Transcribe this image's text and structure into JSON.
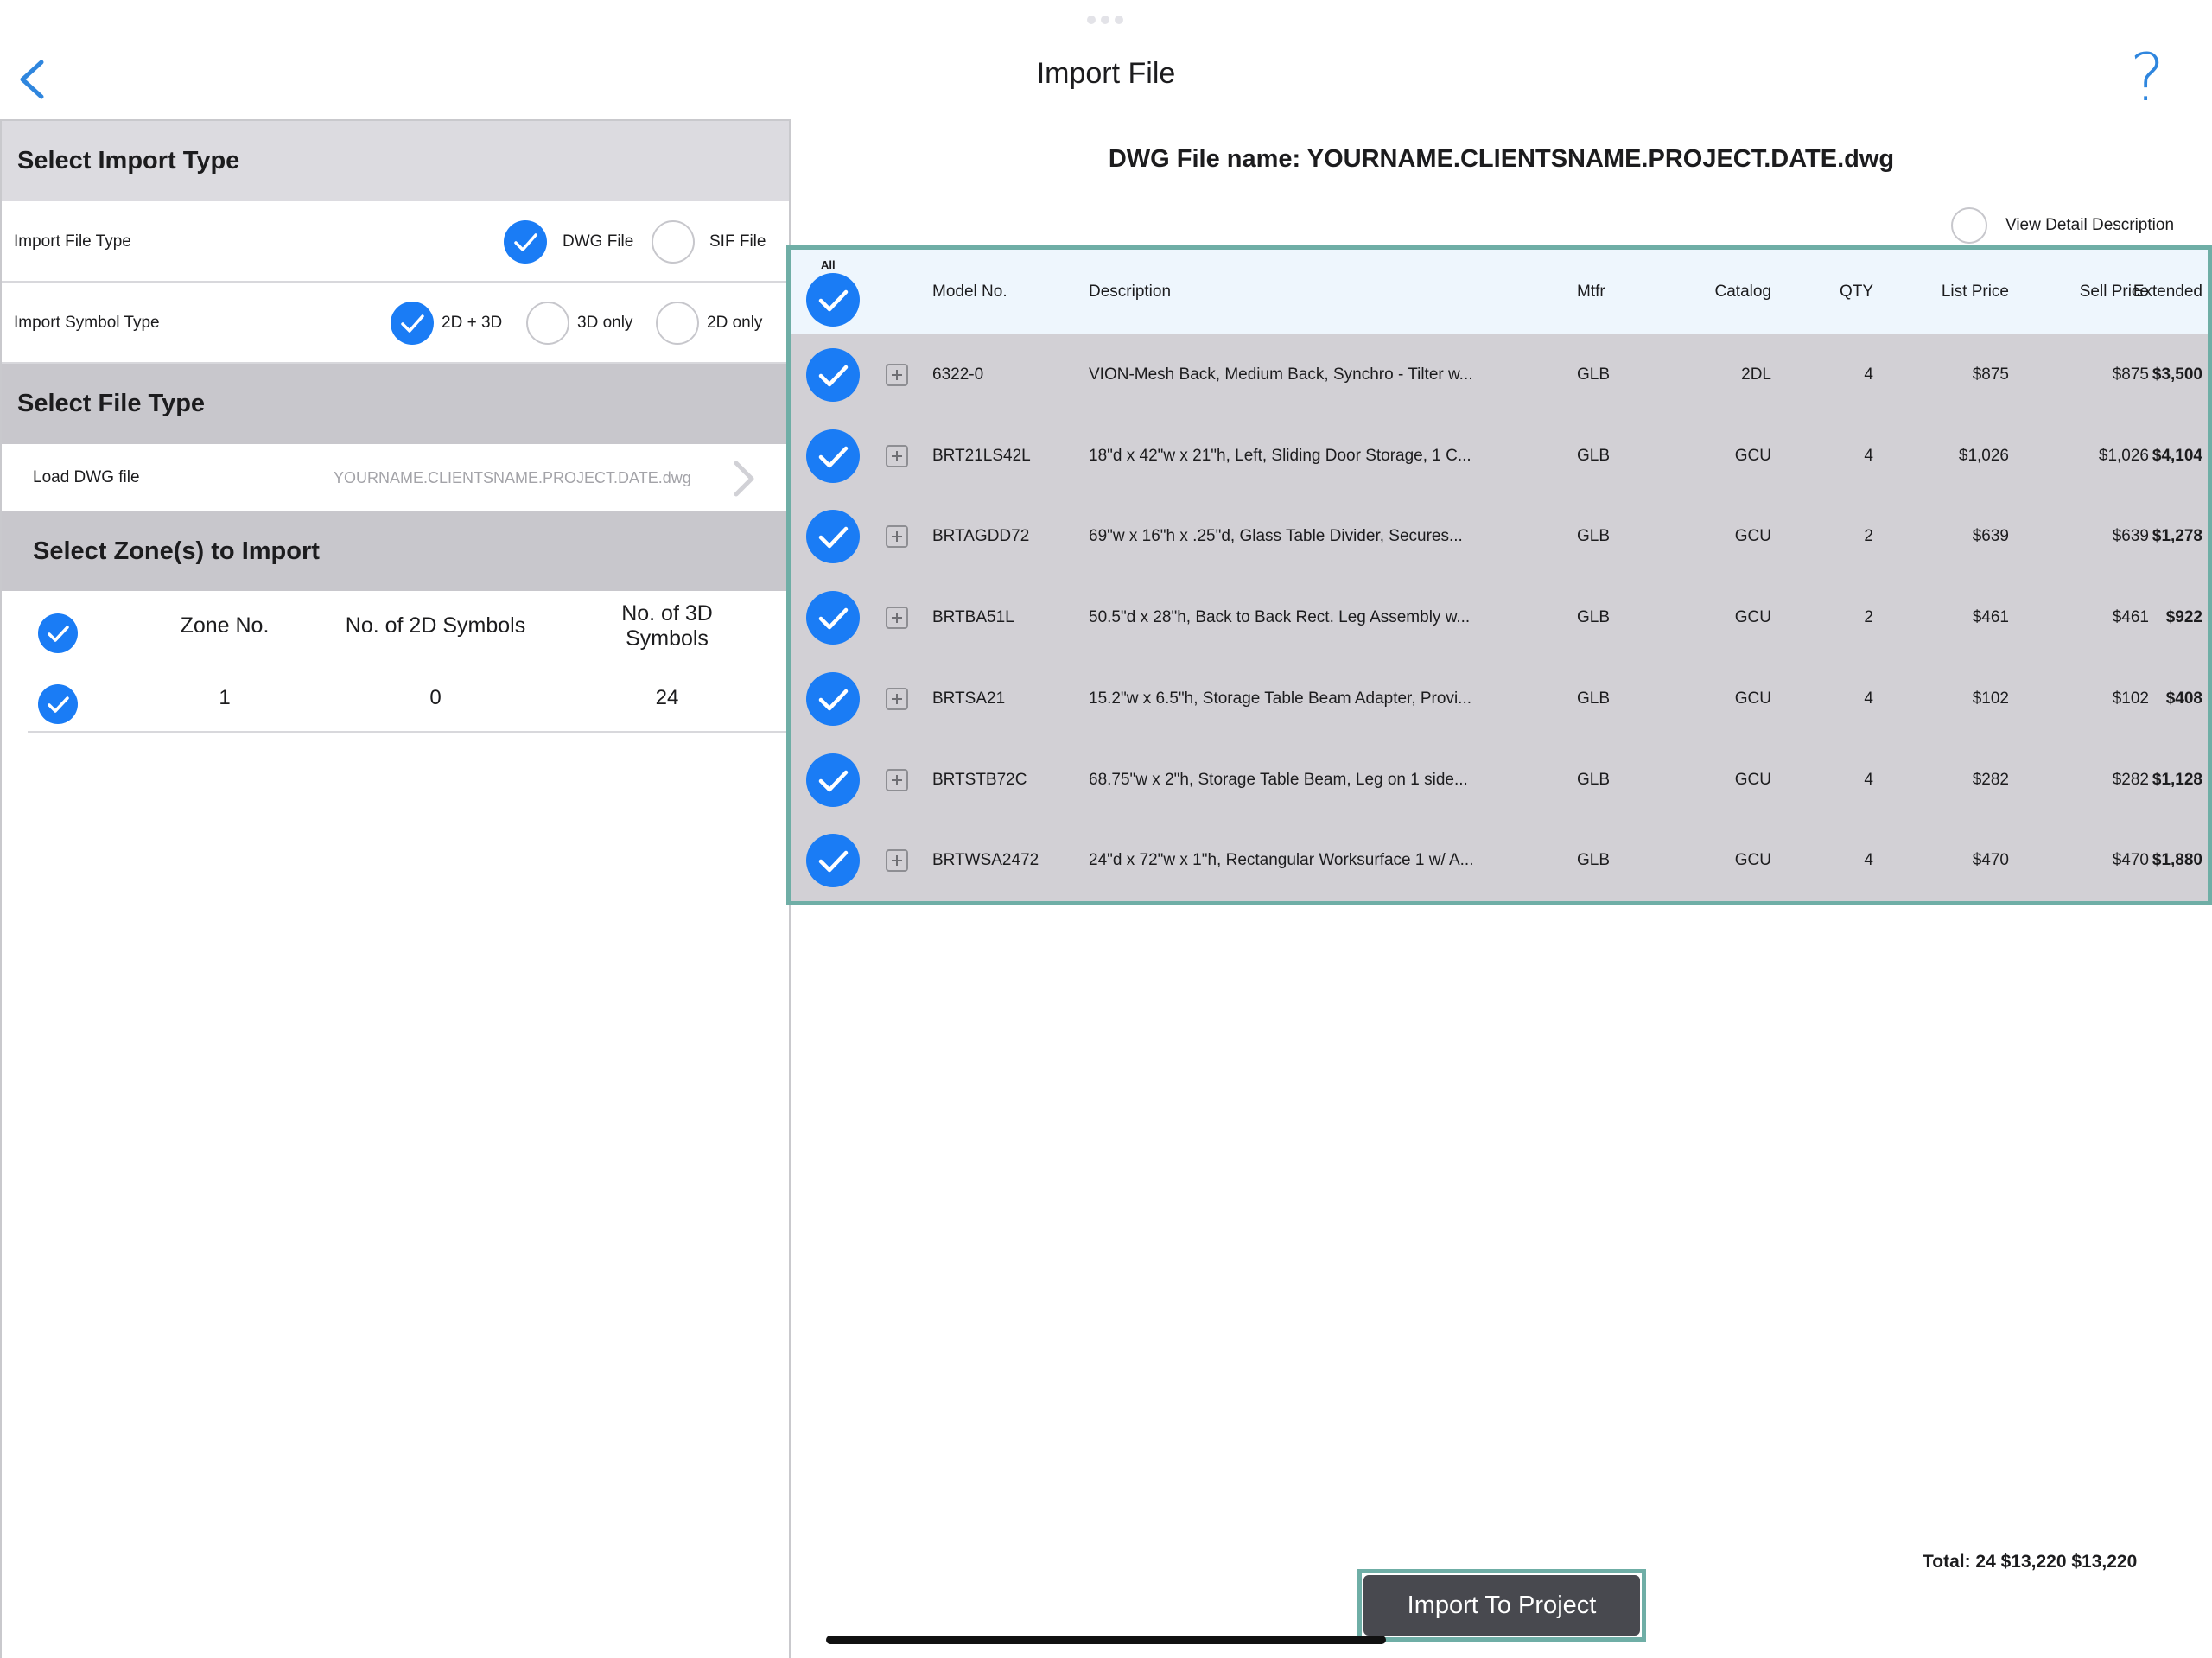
{
  "header": {
    "title": "Import File",
    "back_icon": "chevron-left-icon",
    "help_label": "?"
  },
  "import_type": {
    "section_title": "Select Import Type",
    "file_type_label": "Import File Type",
    "file_type_options": [
      {
        "label": "DWG File",
        "selected": true
      },
      {
        "label": "SIF File",
        "selected": false
      }
    ],
    "symbol_type_label": "Import Symbol Type",
    "symbol_type_options": [
      {
        "label": "2D + 3D",
        "selected": true
      },
      {
        "label": "3D only",
        "selected": false
      },
      {
        "label": "2D only",
        "selected": false
      }
    ]
  },
  "file_type": {
    "section_title": "Select File Type",
    "load_label": "Load DWG file",
    "file_path": "YOURNAME.CLIENTSNAME.PROJECT.DATE.dwg"
  },
  "zones": {
    "section_title": "Select Zone(s) to Import",
    "headers": {
      "zone_no": "Zone No.",
      "no_2d": "No. of 2D Symbols",
      "no_3d_line1": "No. of 3D",
      "no_3d_line2": "Symbols"
    },
    "rows": [
      {
        "zone_no": "1",
        "no_2d": "0",
        "no_3d": "24",
        "selected": true
      }
    ]
  },
  "file_info": {
    "title": "DWG File name: YOURNAME.CLIENTSNAME.PROJECT.DATE.dwg",
    "detail_toggle_label": "View Detail Description"
  },
  "table": {
    "all_label": "All",
    "columns": {
      "model": "Model No.",
      "description": "Description",
      "mtfr": "Mtfr",
      "catalog": "Catalog",
      "qty": "QTY",
      "list": "List Price",
      "sell": "Sell Price",
      "extended": "Extended"
    },
    "rows": [
      {
        "model": "6322-0",
        "description": "VION-Mesh Back, Medium Back, Synchro - Tilter w...",
        "mtfr": "GLB",
        "catalog": "2DL",
        "qty": "4",
        "list": "$875",
        "sell": "$875",
        "extended": "$3,500"
      },
      {
        "model": "BRT21LS42L",
        "description": "18\"d x 42\"w x 21\"h, Left, Sliding Door Storage, 1 C...",
        "mtfr": "GLB",
        "catalog": "GCU",
        "qty": "4",
        "list": "$1,026",
        "sell": "$1,026",
        "extended": "$4,104"
      },
      {
        "model": "BRTAGDD72",
        "description": "69\"w x 16\"h x .25\"d, Glass Table Divider, Secures...",
        "mtfr": "GLB",
        "catalog": "GCU",
        "qty": "2",
        "list": "$639",
        "sell": "$639",
        "extended": "$1,278"
      },
      {
        "model": "BRTBA51L",
        "description": "50.5\"d x 28\"h, Back to Back Rect. Leg Assembly w...",
        "mtfr": "GLB",
        "catalog": "GCU",
        "qty": "2",
        "list": "$461",
        "sell": "$461",
        "extended": "$922"
      },
      {
        "model": "BRTSA21",
        "description": "15.2\"w x 6.5\"h, Storage Table Beam Adapter, Provi...",
        "mtfr": "GLB",
        "catalog": "GCU",
        "qty": "4",
        "list": "$102",
        "sell": "$102",
        "extended": "$408"
      },
      {
        "model": "BRTSTB72C",
        "description": "68.75\"w x 2\"h, Storage Table Beam, Leg on 1 side...",
        "mtfr": "GLB",
        "catalog": "GCU",
        "qty": "4",
        "list": "$282",
        "sell": "$282",
        "extended": "$1,128"
      },
      {
        "model": "BRTWSA2472",
        "description": "24\"d x 72\"w x 1\"h, Rectangular Worksurface 1 w/ A...",
        "mtfr": "GLB",
        "catalog": "GCU",
        "qty": "4",
        "list": "$470",
        "sell": "$470",
        "extended": "$1,880"
      }
    ]
  },
  "totals": {
    "text": "Total: 24   $13,220   $13,220"
  },
  "actions": {
    "import_label": "Import To Project"
  },
  "colors": {
    "accent": "#1a7cf5",
    "highlight_frame": "#6faea6",
    "section_header": "#c8c7cc",
    "table_row_bg": "#d2d0d5",
    "table_head_bg": "#eef6fd",
    "button_bg": "#48494f"
  }
}
